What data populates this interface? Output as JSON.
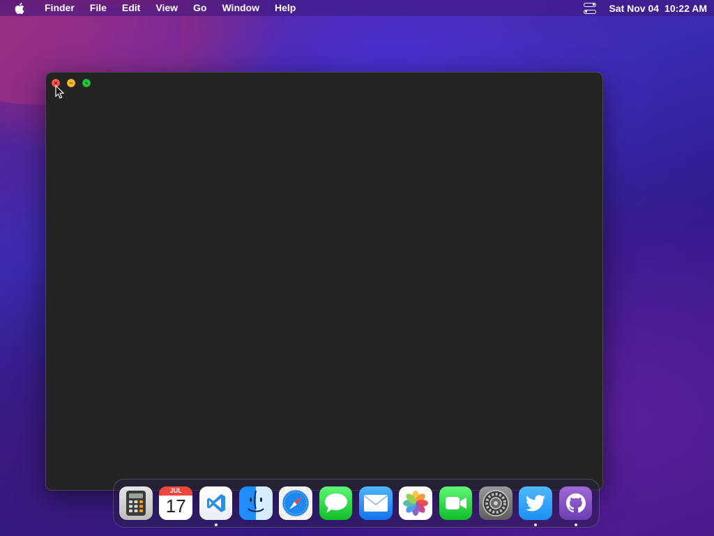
{
  "menubar": {
    "apple_icon": "apple-logo-icon",
    "app_name": "Finder",
    "items": [
      "File",
      "Edit",
      "View",
      "Go",
      "Window",
      "Help"
    ],
    "control_center_icon": "control-center-icon",
    "date": "Sat Nov 04",
    "time": "10:22 AM"
  },
  "window": {
    "background": "#232323",
    "traffic_lights": {
      "close_color": "#ff5f57",
      "minimize_color": "#febc2e",
      "maximize_color": "#28c840"
    }
  },
  "dock": {
    "items": [
      {
        "name": "Calculator",
        "icon": "calculator-icon",
        "running": false
      },
      {
        "name": "Calendar",
        "icon": "calendar-icon",
        "running": false,
        "month": "JUL",
        "day": "17"
      },
      {
        "name": "Visual Studio Code",
        "icon": "vscode-icon",
        "running": true
      },
      {
        "name": "Finder",
        "icon": "finder-icon",
        "running": false
      },
      {
        "name": "Safari",
        "icon": "safari-icon",
        "running": false
      },
      {
        "name": "Messages",
        "icon": "messages-icon",
        "running": false
      },
      {
        "name": "Mail",
        "icon": "mail-icon",
        "running": false
      },
      {
        "name": "Photos",
        "icon": "photos-icon",
        "running": false
      },
      {
        "name": "FaceTime",
        "icon": "facetime-icon",
        "running": false
      },
      {
        "name": "System Preferences",
        "icon": "settings-gear-icon",
        "running": false
      },
      {
        "name": "Twitter",
        "icon": "twitter-bird-icon",
        "running": true
      },
      {
        "name": "GitHub Desktop",
        "icon": "github-octocat-icon",
        "running": true
      }
    ]
  }
}
